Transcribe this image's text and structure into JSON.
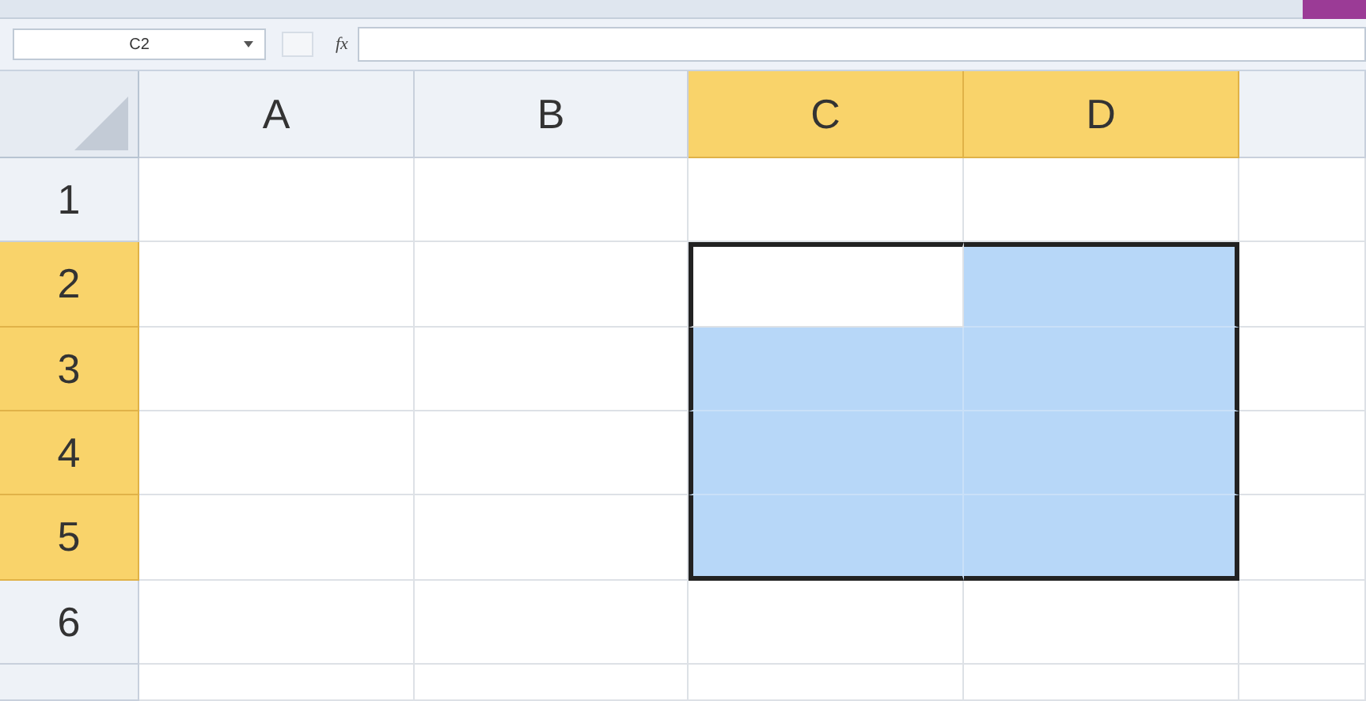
{
  "formula_bar": {
    "name_box": "C2",
    "fx_label": "fx"
  },
  "columns": [
    {
      "label": "A",
      "selected": false
    },
    {
      "label": "B",
      "selected": false
    },
    {
      "label": "C",
      "selected": true
    },
    {
      "label": "D",
      "selected": true
    },
    {
      "selected": false
    }
  ],
  "rows": [
    {
      "label": "1",
      "selected": false,
      "cells": [
        {
          "selected": false,
          "active": false
        },
        {
          "selected": false,
          "active": false
        },
        {
          "selected": false,
          "active": false
        },
        {
          "selected": false,
          "active": false
        },
        {
          "selected": false,
          "active": false
        }
      ]
    },
    {
      "label": "2",
      "selected": true,
      "cells": [
        {
          "selected": false,
          "active": false
        },
        {
          "selected": false,
          "active": false
        },
        {
          "selected": true,
          "active": true
        },
        {
          "selected": true,
          "active": false
        },
        {
          "selected": false,
          "active": false
        }
      ]
    },
    {
      "label": "3",
      "selected": true,
      "cells": [
        {
          "selected": false,
          "active": false
        },
        {
          "selected": false,
          "active": false
        },
        {
          "selected": true,
          "active": false
        },
        {
          "selected": true,
          "active": false
        },
        {
          "selected": false,
          "active": false
        }
      ]
    },
    {
      "label": "4",
      "selected": true,
      "cells": [
        {
          "selected": false,
          "active": false
        },
        {
          "selected": false,
          "active": false
        },
        {
          "selected": true,
          "active": false
        },
        {
          "selected": true,
          "active": false
        },
        {
          "selected": false,
          "active": false
        }
      ]
    },
    {
      "label": "5",
      "selected": true,
      "cells": [
        {
          "selected": false,
          "active": false
        },
        {
          "selected": false,
          "active": false
        },
        {
          "selected": true,
          "active": false
        },
        {
          "selected": true,
          "active": false
        },
        {
          "selected": false,
          "active": false
        }
      ]
    },
    {
      "label": "6",
      "selected": false,
      "cells": [
        {
          "selected": false,
          "active": false
        },
        {
          "selected": false,
          "active": false
        },
        {
          "selected": false,
          "active": false
        },
        {
          "selected": false,
          "active": false
        },
        {
          "selected": false,
          "active": false
        }
      ]
    },
    {
      "selected": false,
      "cells": [
        {
          "selected": false,
          "active": false
        },
        {
          "selected": false,
          "active": false
        },
        {
          "selected": false,
          "active": false
        },
        {
          "selected": false,
          "active": false
        },
        {
          "selected": false,
          "active": false
        }
      ]
    }
  ]
}
